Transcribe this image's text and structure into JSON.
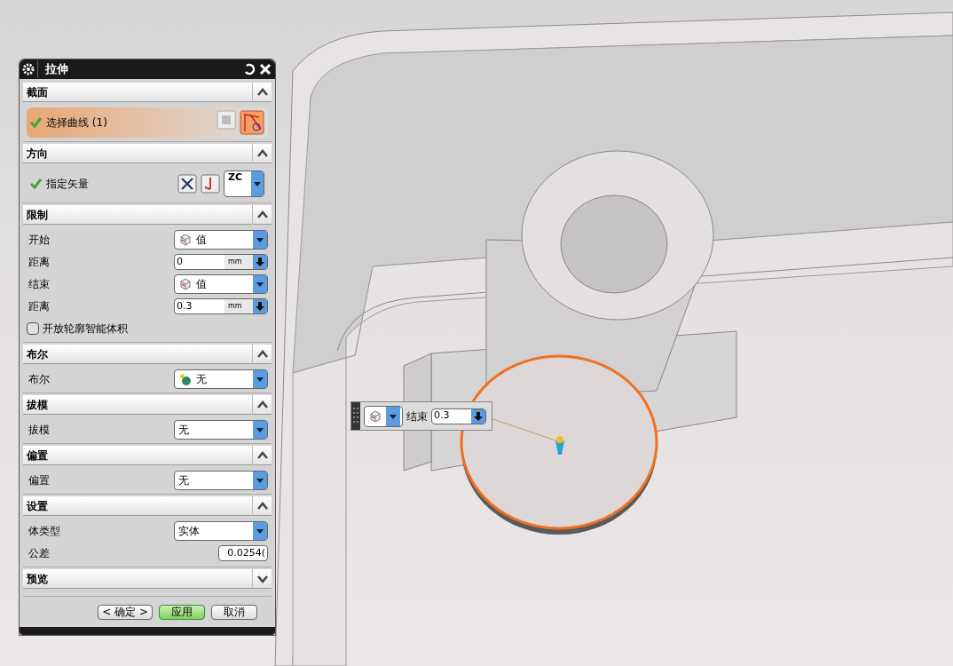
{
  "dialog": {
    "title": "拉伸",
    "sections": [
      {
        "title": "截面",
        "expanded": true,
        "rows": [
          {
            "kind": "selection",
            "label": "选择曲线 (1)",
            "done": true
          }
        ]
      },
      {
        "title": "方向",
        "expanded": true,
        "rows": [
          {
            "kind": "vector",
            "label": "指定矢量",
            "done": true,
            "value": "ZC"
          }
        ]
      },
      {
        "title": "限制",
        "expanded": true,
        "rows": [
          {
            "kind": "limit",
            "label": "开始",
            "value": "值"
          },
          {
            "kind": "number",
            "label": "距离",
            "value": "0",
            "unit": "mm"
          },
          {
            "kind": "limit",
            "label": "结束",
            "value": "值"
          },
          {
            "kind": "number",
            "label": "距离",
            "value": "0.3",
            "unit": "mm"
          },
          {
            "kind": "checkbox",
            "label": "开放轮廓智能体积",
            "checked": false
          }
        ]
      },
      {
        "title": "布尔",
        "expanded": true,
        "rows": [
          {
            "kind": "boolean",
            "label": "布尔",
            "value": "无"
          }
        ]
      },
      {
        "title": "拔模",
        "expanded": true,
        "rows": [
          {
            "kind": "dropdown",
            "label": "拔模",
            "value": "无"
          }
        ]
      },
      {
        "title": "偏置",
        "expanded": true,
        "rows": [
          {
            "kind": "dropdown",
            "label": "偏置",
            "value": "无"
          }
        ]
      },
      {
        "title": "设置",
        "expanded": true,
        "rows": [
          {
            "kind": "dropdown",
            "label": "体类型",
            "value": "实体"
          },
          {
            "kind": "text",
            "label": "公差",
            "value": "0.0254("
          }
        ]
      },
      {
        "title": "预览",
        "expanded": false
      }
    ],
    "buttons": [
      {
        "label": "< 确定 >",
        "default": false
      },
      {
        "label": "应用",
        "default": true
      },
      {
        "label": "取消",
        "default": false
      }
    ]
  },
  "floating_toolbar": {
    "label": "结束",
    "value": "0.3"
  }
}
